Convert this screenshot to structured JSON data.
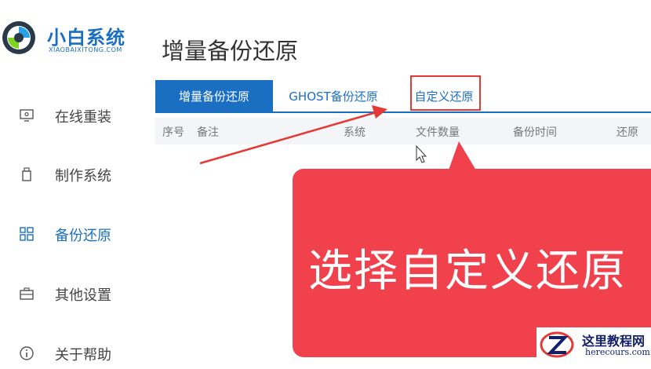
{
  "brand": {
    "name": "小白系统",
    "sub": "XIAOBAIXITONG.COM"
  },
  "sidebar": {
    "items": [
      {
        "label": "在线重装",
        "icon": "monitor-icon"
      },
      {
        "label": "制作系统",
        "icon": "usb-icon"
      },
      {
        "label": "备份还原",
        "icon": "grid-icon",
        "active": true
      },
      {
        "label": "其他设置",
        "icon": "briefcase-icon"
      },
      {
        "label": "关于帮助",
        "icon": "info-icon"
      }
    ]
  },
  "main": {
    "title": "增量备份还原",
    "tabs": [
      {
        "label": "增量备份还原",
        "active": true
      },
      {
        "label": "GHOST备份还原"
      },
      {
        "label": "自定义还原"
      }
    ],
    "table": {
      "columns": [
        "序号",
        "备注",
        "系统",
        "文件数量",
        "备份时间",
        "还原"
      ]
    }
  },
  "annotation": {
    "callout": "选择自定义还原"
  },
  "watermark": {
    "title": "这里教程网",
    "url": "herecours.com"
  },
  "colors": {
    "accent": "#1a6fc2",
    "callout": "#f0414d",
    "highlight": "#e53935"
  }
}
